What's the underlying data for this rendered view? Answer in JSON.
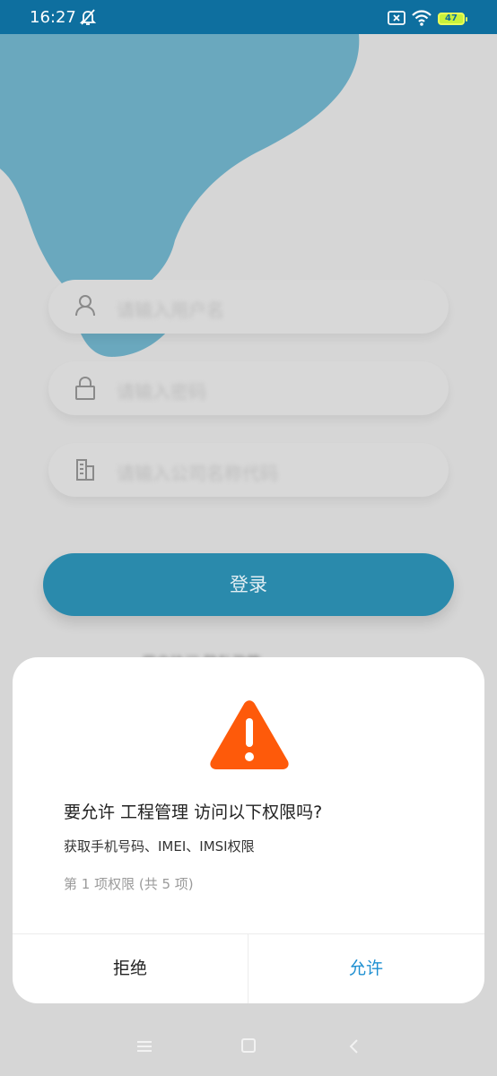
{
  "status_bar": {
    "time": "16:27",
    "battery": "47"
  },
  "login_form": {
    "username_placeholder": "请输入用户名",
    "password_placeholder": "请输入密码",
    "company_placeholder": "请输入公司名称代码",
    "login_button": "登录",
    "footer_text": "用户协议 隐私政策"
  },
  "permission_dialog": {
    "title": "要允许 工程管理 访问以下权限吗?",
    "description": "获取手机号码、IMEI、IMSI权限",
    "progress": "第 1 项权限 (共 5 项)",
    "deny_label": "拒绝",
    "allow_label": "允许"
  },
  "colors": {
    "status_bar": "#0e6f9f",
    "primary_button": "#2a8aac",
    "warning": "#fe5a0a",
    "allow_text": "#1e8fd1"
  }
}
